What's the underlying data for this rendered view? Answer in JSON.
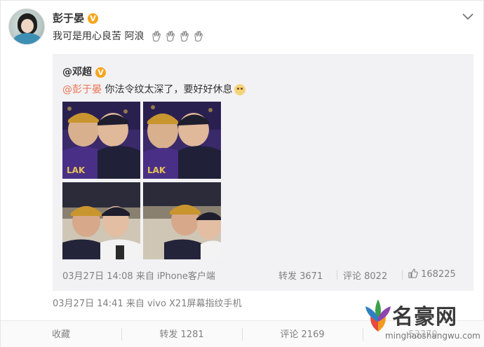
{
  "post": {
    "username": "彭于晏",
    "verified_badge": "V",
    "text": "我可是用心良苦 阿浪",
    "emoji": "clapping-hands-icon",
    "meta": "03月27日 14:41 来自 vivo X21屏幕指纹手机"
  },
  "repost": {
    "original_user": "@邓超",
    "mention": "@彭于晏",
    "text": " 你法令纹太深了，要好好休息",
    "meta": "03月27日 14:08 来自 iPhone客户端",
    "repost_count": "转发 3671",
    "comment_count": "评论 8022",
    "like_count": "168225",
    "photos": [
      "stadium-selfie-1",
      "stadium-selfie-2",
      "stadium-selfie-3",
      "stadium-selfie-4"
    ]
  },
  "actions": {
    "favorite": "收藏",
    "repost": "转发 1281",
    "comment": "评论 2169",
    "like": "53370"
  },
  "watermark": {
    "title": "名豪网",
    "url": "minghaoshangwu.com"
  },
  "colors": {
    "mention": "#eb7350",
    "badge": "#f7a51c",
    "muted": "#808080",
    "repost_bg": "#f2f2f5"
  }
}
